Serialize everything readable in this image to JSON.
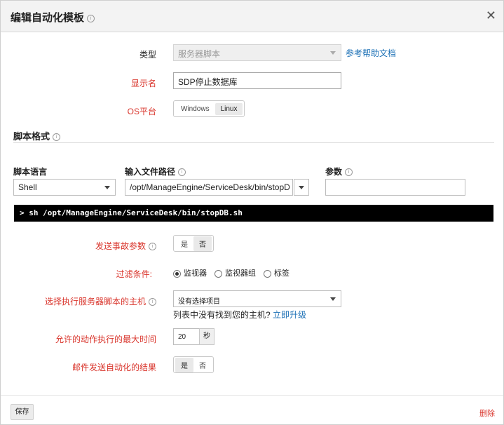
{
  "dialog": {
    "title": "编辑自动化模板"
  },
  "form": {
    "type": {
      "label": "类型",
      "value": "服务器脚本",
      "help_link": "参考帮助文档"
    },
    "display_name": {
      "label": "显示名",
      "value": "SDP停止数据库"
    },
    "os": {
      "label": "OS平台",
      "options": [
        "Windows",
        "Linux"
      ],
      "selected": "Linux"
    }
  },
  "script_format": {
    "title": "脚本格式",
    "language": {
      "label": "脚本语言",
      "value": "Shell"
    },
    "input_path": {
      "label": "输入文件路径",
      "value": "/opt/ManageEngine/ServiceDesk/bin/stopD"
    },
    "params": {
      "label": "参数",
      "value": ""
    },
    "command_preview": "> sh /opt/ManageEngine/ServiceDesk/bin/stopDB.sh"
  },
  "options": {
    "send_incident_params": {
      "label": "发送事故参数",
      "options": [
        "是",
        "否"
      ],
      "selected": "否"
    },
    "filter": {
      "label": "过滤条件:",
      "options": [
        "监视器",
        "监视器组",
        "标签"
      ],
      "selected": "监视器"
    },
    "host": {
      "label": "选择执行服务器脚本的主机",
      "value": "没有选择项目",
      "hint": "列表中没有找到您的主机?",
      "upgrade_link": "立即升级"
    },
    "max_time": {
      "label": "允许的动作执行的最大时间",
      "value": "20",
      "unit": "秒"
    },
    "email_result": {
      "label": "邮件发送自动化的结果",
      "options": [
        "是",
        "否"
      ],
      "selected": "是"
    }
  },
  "footer": {
    "save": "保存",
    "delete": "删除"
  }
}
